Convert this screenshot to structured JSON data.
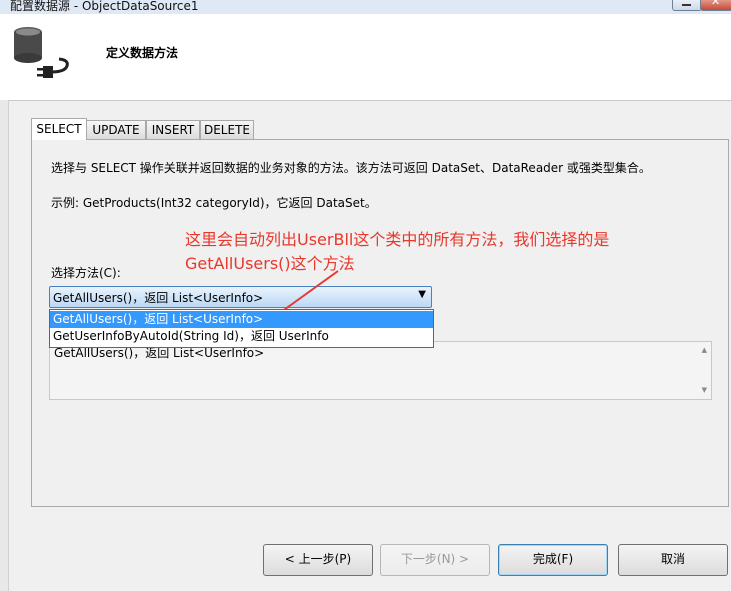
{
  "window": {
    "title": "配置数据源 - ObjectDataSource1"
  },
  "header": {
    "heading": "定义数据方法",
    "icon": "database-plug-icon"
  },
  "tabs": [
    {
      "label": "SELECT",
      "active": true
    },
    {
      "label": "UPDATE",
      "active": false
    },
    {
      "label": "INSERT",
      "active": false
    },
    {
      "label": "DELETE",
      "active": false
    }
  ],
  "panel": {
    "description": "选择与 SELECT 操作关联并返回数据的业务对象的方法。该方法可返回 DataSet、DataReader 或强类型集合。",
    "example": "示例: GetProducts(Int32 categoryId)，它返回 DataSet。",
    "annotation_line1": "这里会自动列出UserBll这个类中的所有方法，我们选择的是",
    "annotation_line2": "GetAllUsers()这个方法",
    "annotation_color": "#e8372b",
    "method_label": "选择方法(C):",
    "selected_method": "GetAllUsers()，返回 List<UserInfo>",
    "options": [
      "GetAllUsers()，返回 List<UserInfo>",
      "GetUserInfoByAutoId(String Id)，返回 UserInfo"
    ],
    "signature": "GetAllUsers()，返回 List<UserInfo>"
  },
  "buttons": {
    "prev": "< 上一步(P)",
    "next": "下一步(N) >",
    "finish": "完成(F)",
    "cancel": "取消"
  }
}
